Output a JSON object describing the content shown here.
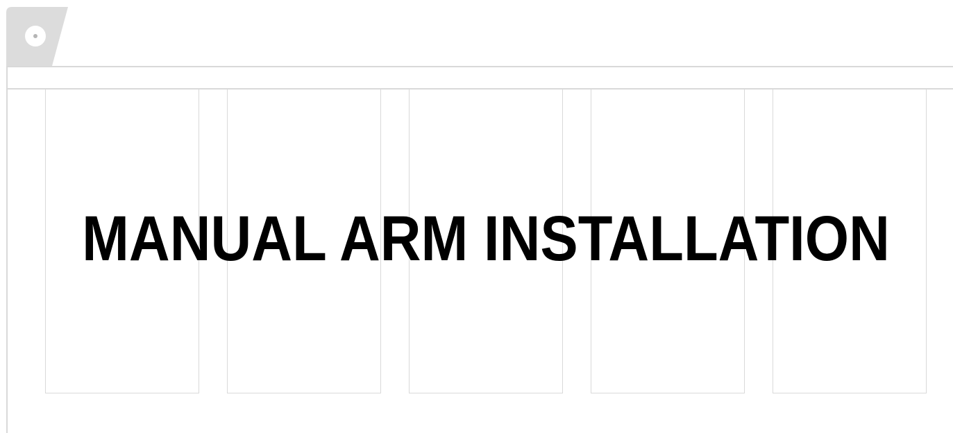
{
  "document": {
    "title": "MANUAL ARM INSTALLATION"
  },
  "decor": {
    "frame_color": "#d9d9d9",
    "tab_color": "#dcdcdc",
    "text_color": "#000000",
    "corner_icon": "disc-icon",
    "panel_count": 5
  }
}
